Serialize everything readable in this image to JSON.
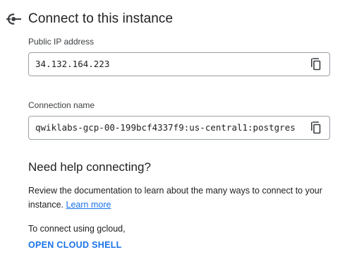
{
  "header": {
    "icon": "connection-icon",
    "title": "Connect to this instance"
  },
  "public_ip": {
    "label": "Public IP address",
    "value": "34.132.164.223",
    "copy_icon": "copy-icon"
  },
  "connection_name": {
    "label": "Connection name",
    "value": "qwiklabs-gcp-00-199bcf4337f9:us-central1:postgres",
    "copy_icon": "copy-icon"
  },
  "help": {
    "title": "Need help connecting?",
    "text": "Review the documentation to learn about the many ways to connect to your instance.",
    "link": "Learn more"
  },
  "gcloud": {
    "text": "To connect using gcloud,",
    "link": "OPEN CLOUD SHELL"
  },
  "colors": {
    "link": "#1a73e8",
    "text": "#202124",
    "icon": "#5f6368",
    "border": "#9aa0a6"
  }
}
